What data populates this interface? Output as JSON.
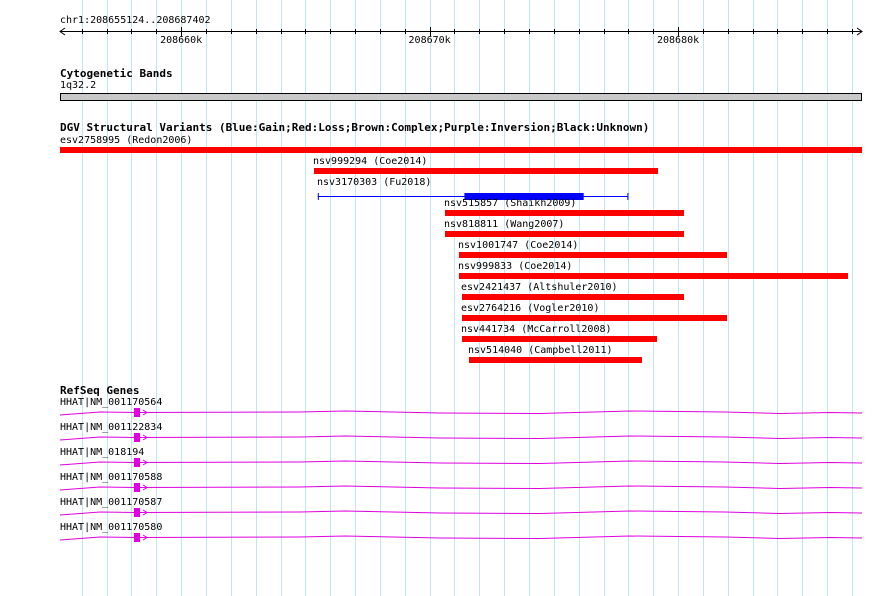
{
  "position_label": "chr1:208655124..208687402",
  "ruler": {
    "ticks": [
      {
        "pos": 208660000,
        "label": "208660k"
      },
      {
        "pos": 208670000,
        "label": "208670k"
      },
      {
        "pos": 208680000,
        "label": "208680k"
      }
    ]
  },
  "cytoband": {
    "title": "Cytogenetic Bands",
    "band": "1q32.2"
  },
  "dgv": {
    "title": "DGV Structural Variants (Blue:Gain;Red:Loss;Brown:Complex;Purple:Inversion;Black:Unknown)",
    "variants": [
      {
        "label": "esv2758995 (Redon2006)",
        "start": 208655124,
        "end": 208687402,
        "color": "#ff0000"
      },
      {
        "label": "nsv999294 (Coe2014)",
        "start": 208665350,
        "end": 208679200,
        "color": "#ff0000"
      },
      {
        "label": "nsv3170303 (Fu2018)",
        "start": 208665500,
        "end": 208678000,
        "color": "#0000ff",
        "thick_start": 208671400,
        "thick_end": 208676200
      },
      {
        "label": "nsv515857 (Shaikh2009)",
        "start": 208670600,
        "end": 208680250,
        "color": "#ff0000"
      },
      {
        "label": "nsv818811 (Wang2007)",
        "start": 208670600,
        "end": 208680250,
        "color": "#ff0000"
      },
      {
        "label": "nsv1001747 (Coe2014)",
        "start": 208671200,
        "end": 208681950,
        "color": "#ff0000"
      },
      {
        "label": "nsv999833 (Coe2014)",
        "start": 208671200,
        "end": 208686850,
        "color": "#ff0000"
      },
      {
        "label": "esv2421437 (Altshuler2010)",
        "start": 208671300,
        "end": 208680250,
        "color": "#ff0000"
      },
      {
        "label": "esv2764216 (Vogler2010)",
        "start": 208671300,
        "end": 208681950,
        "color": "#ff0000"
      },
      {
        "label": "nsv441734 (McCarroll2008)",
        "start": 208671300,
        "end": 208679150,
        "color": "#ff0000"
      },
      {
        "label": "nsv514040 (Campbell2011)",
        "start": 208671600,
        "end": 208678550,
        "color": "#ff0000"
      }
    ]
  },
  "refseq": {
    "title": "RefSeq Genes",
    "color": "#e000e0",
    "genes": [
      {
        "label": "HHAT|NM_001170564"
      },
      {
        "label": "HHAT|NM_001122834"
      },
      {
        "label": "HHAT|NM_018194"
      },
      {
        "label": "HHAT|NM_001170588"
      },
      {
        "label": "HHAT|NM_001170587"
      },
      {
        "label": "HHAT|NM_001170580"
      }
    ]
  }
}
